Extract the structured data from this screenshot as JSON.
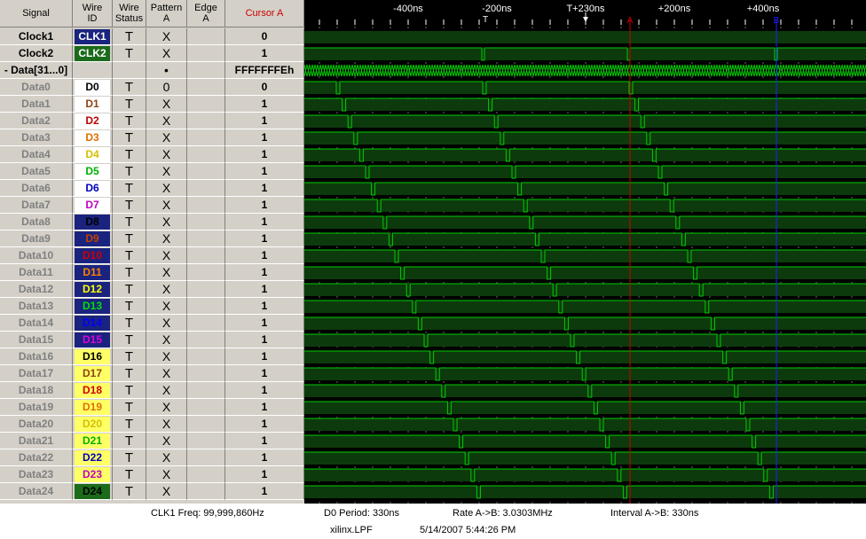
{
  "header": {
    "signal": "Signal",
    "wire_id": "Wire\nID",
    "wire_status": "Wire\nStatus",
    "pattern": "Pattern\nA",
    "edge": "Edge\nA",
    "cursor": "Cursor A"
  },
  "colors": {
    "panel_bg": "#d4d0c8",
    "wave_bg": "#000000",
    "wave_fill": "#0d3a0d",
    "wave_line": "#00cc00",
    "cursor_a": "#cc0000",
    "cursor_b": "#2020ff",
    "cursor_header": "#cc0000"
  },
  "timeline": {
    "labels": [
      {
        "text": "-400ns",
        "t": -400
      },
      {
        "text": "-200ns",
        "t": -200
      },
      {
        "text": "T+230ns",
        "t": 0
      },
      {
        "text": "+200ns",
        "t": 200
      },
      {
        "text": "+400ns",
        "t": 400
      }
    ],
    "marker_t": "T",
    "marker_a": "A",
    "marker_b": "B"
  },
  "signals": [
    {
      "name": "Clock1",
      "id": "CLK1",
      "id_bg": "#1a237e",
      "id_fg": "#ffffff",
      "status": "T",
      "pattern": "X",
      "edge": "",
      "cursor": "0",
      "dim": false
    },
    {
      "name": "Clock2",
      "id": "CLK2",
      "id_bg": "#1b6b1b",
      "id_fg": "#ffffff",
      "status": "T",
      "pattern": "X",
      "edge": "",
      "cursor": "1",
      "dim": false
    },
    {
      "name": "- Data[31...0]",
      "id": "",
      "id_bg": "",
      "id_fg": "",
      "status": "",
      "pattern": "•",
      "edge": "",
      "cursor": "FFFFFFFEh",
      "dim": false
    },
    {
      "name": "Data0",
      "id": "D0",
      "id_bg": "#ffffff",
      "id_fg": "#000000",
      "status": "T",
      "pattern": "0",
      "edge": "",
      "cursor": "0",
      "dim": true
    },
    {
      "name": "Data1",
      "id": "D1",
      "id_bg": "#ffffff",
      "id_fg": "#8b4513",
      "status": "T",
      "pattern": "X",
      "edge": "",
      "cursor": "1",
      "dim": true
    },
    {
      "name": "Data2",
      "id": "D2",
      "id_bg": "#ffffff",
      "id_fg": "#c00000",
      "status": "T",
      "pattern": "X",
      "edge": "",
      "cursor": "1",
      "dim": true
    },
    {
      "name": "Data3",
      "id": "D3",
      "id_bg": "#ffffff",
      "id_fg": "#e07000",
      "status": "T",
      "pattern": "X",
      "edge": "",
      "cursor": "1",
      "dim": true
    },
    {
      "name": "Data4",
      "id": "D4",
      "id_bg": "#ffffff",
      "id_fg": "#d4c000",
      "status": "T",
      "pattern": "X",
      "edge": "",
      "cursor": "1",
      "dim": true
    },
    {
      "name": "Data5",
      "id": "D5",
      "id_bg": "#ffffff",
      "id_fg": "#00b000",
      "status": "T",
      "pattern": "X",
      "edge": "",
      "cursor": "1",
      "dim": true
    },
    {
      "name": "Data6",
      "id": "D6",
      "id_bg": "#ffffff",
      "id_fg": "#0000c0",
      "status": "T",
      "pattern": "X",
      "edge": "",
      "cursor": "1",
      "dim": true
    },
    {
      "name": "Data7",
      "id": "D7",
      "id_bg": "#ffffff",
      "id_fg": "#c000c0",
      "status": "T",
      "pattern": "X",
      "edge": "",
      "cursor": "1",
      "dim": true
    },
    {
      "name": "Data8",
      "id": "D8",
      "id_bg": "#1a237e",
      "id_fg": "#000000",
      "status": "T",
      "pattern": "X",
      "edge": "",
      "cursor": "1",
      "dim": true
    },
    {
      "name": "Data9",
      "id": "D9",
      "id_bg": "#1a237e",
      "id_fg": "#c04000",
      "status": "T",
      "pattern": "X",
      "edge": "",
      "cursor": "1",
      "dim": true
    },
    {
      "name": "Data10",
      "id": "D10",
      "id_bg": "#1a237e",
      "id_fg": "#d00000",
      "status": "T",
      "pattern": "X",
      "edge": "",
      "cursor": "1",
      "dim": true
    },
    {
      "name": "Data11",
      "id": "D11",
      "id_bg": "#1a237e",
      "id_fg": "#ff8000",
      "status": "T",
      "pattern": "X",
      "edge": "",
      "cursor": "1",
      "dim": true
    },
    {
      "name": "Data12",
      "id": "D12",
      "id_bg": "#1a237e",
      "id_fg": "#ffff00",
      "status": "T",
      "pattern": "X",
      "edge": "",
      "cursor": "1",
      "dim": true
    },
    {
      "name": "Data13",
      "id": "D13",
      "id_bg": "#1a237e",
      "id_fg": "#00e000",
      "status": "T",
      "pattern": "X",
      "edge": "",
      "cursor": "1",
      "dim": true
    },
    {
      "name": "Data14",
      "id": "D14",
      "id_bg": "#1a237e",
      "id_fg": "#0000ff",
      "status": "T",
      "pattern": "X",
      "edge": "",
      "cursor": "1",
      "dim": true
    },
    {
      "name": "Data15",
      "id": "D15",
      "id_bg": "#1a237e",
      "id_fg": "#e000e0",
      "status": "T",
      "pattern": "X",
      "edge": "",
      "cursor": "1",
      "dim": true
    },
    {
      "name": "Data16",
      "id": "D16",
      "id_bg": "#ffff66",
      "id_fg": "#000000",
      "status": "T",
      "pattern": "X",
      "edge": "",
      "cursor": "1",
      "dim": true
    },
    {
      "name": "Data17",
      "id": "D17",
      "id_bg": "#ffff66",
      "id_fg": "#8b4513",
      "status": "T",
      "pattern": "X",
      "edge": "",
      "cursor": "1",
      "dim": true
    },
    {
      "name": "Data18",
      "id": "D18",
      "id_bg": "#ffff66",
      "id_fg": "#d00000",
      "status": "T",
      "pattern": "X",
      "edge": "",
      "cursor": "1",
      "dim": true
    },
    {
      "name": "Data19",
      "id": "D19",
      "id_bg": "#ffff66",
      "id_fg": "#e07000",
      "status": "T",
      "pattern": "X",
      "edge": "",
      "cursor": "1",
      "dim": true
    },
    {
      "name": "Data20",
      "id": "D20",
      "id_bg": "#ffff66",
      "id_fg": "#d4c000",
      "status": "T",
      "pattern": "X",
      "edge": "",
      "cursor": "1",
      "dim": true
    },
    {
      "name": "Data21",
      "id": "D21",
      "id_bg": "#ffff66",
      "id_fg": "#00b000",
      "status": "T",
      "pattern": "X",
      "edge": "",
      "cursor": "1",
      "dim": true
    },
    {
      "name": "Data22",
      "id": "D22",
      "id_bg": "#ffff66",
      "id_fg": "#0000c0",
      "status": "T",
      "pattern": "X",
      "edge": "",
      "cursor": "1",
      "dim": true
    },
    {
      "name": "Data23",
      "id": "D23",
      "id_bg": "#ffff66",
      "id_fg": "#c000c0",
      "status": "T",
      "pattern": "X",
      "edge": "",
      "cursor": "1",
      "dim": true
    },
    {
      "name": "Data24",
      "id": "D24",
      "id_bg": "#1b6b1b",
      "id_fg": "#000000",
      "status": "T",
      "pattern": "X",
      "edge": "",
      "cursor": "1",
      "dim": true
    }
  ],
  "status": {
    "clk_freq": "CLK1 Freq: 99,999,860Hz",
    "d0_period": "D0 Period: 330ns",
    "rate": "Rate A->B: 3.0303MHz",
    "interval": "Interval A->B: 330ns",
    "file": "xilinx.LPF",
    "timestamp": "5/14/2007 5:44:26 PM"
  }
}
